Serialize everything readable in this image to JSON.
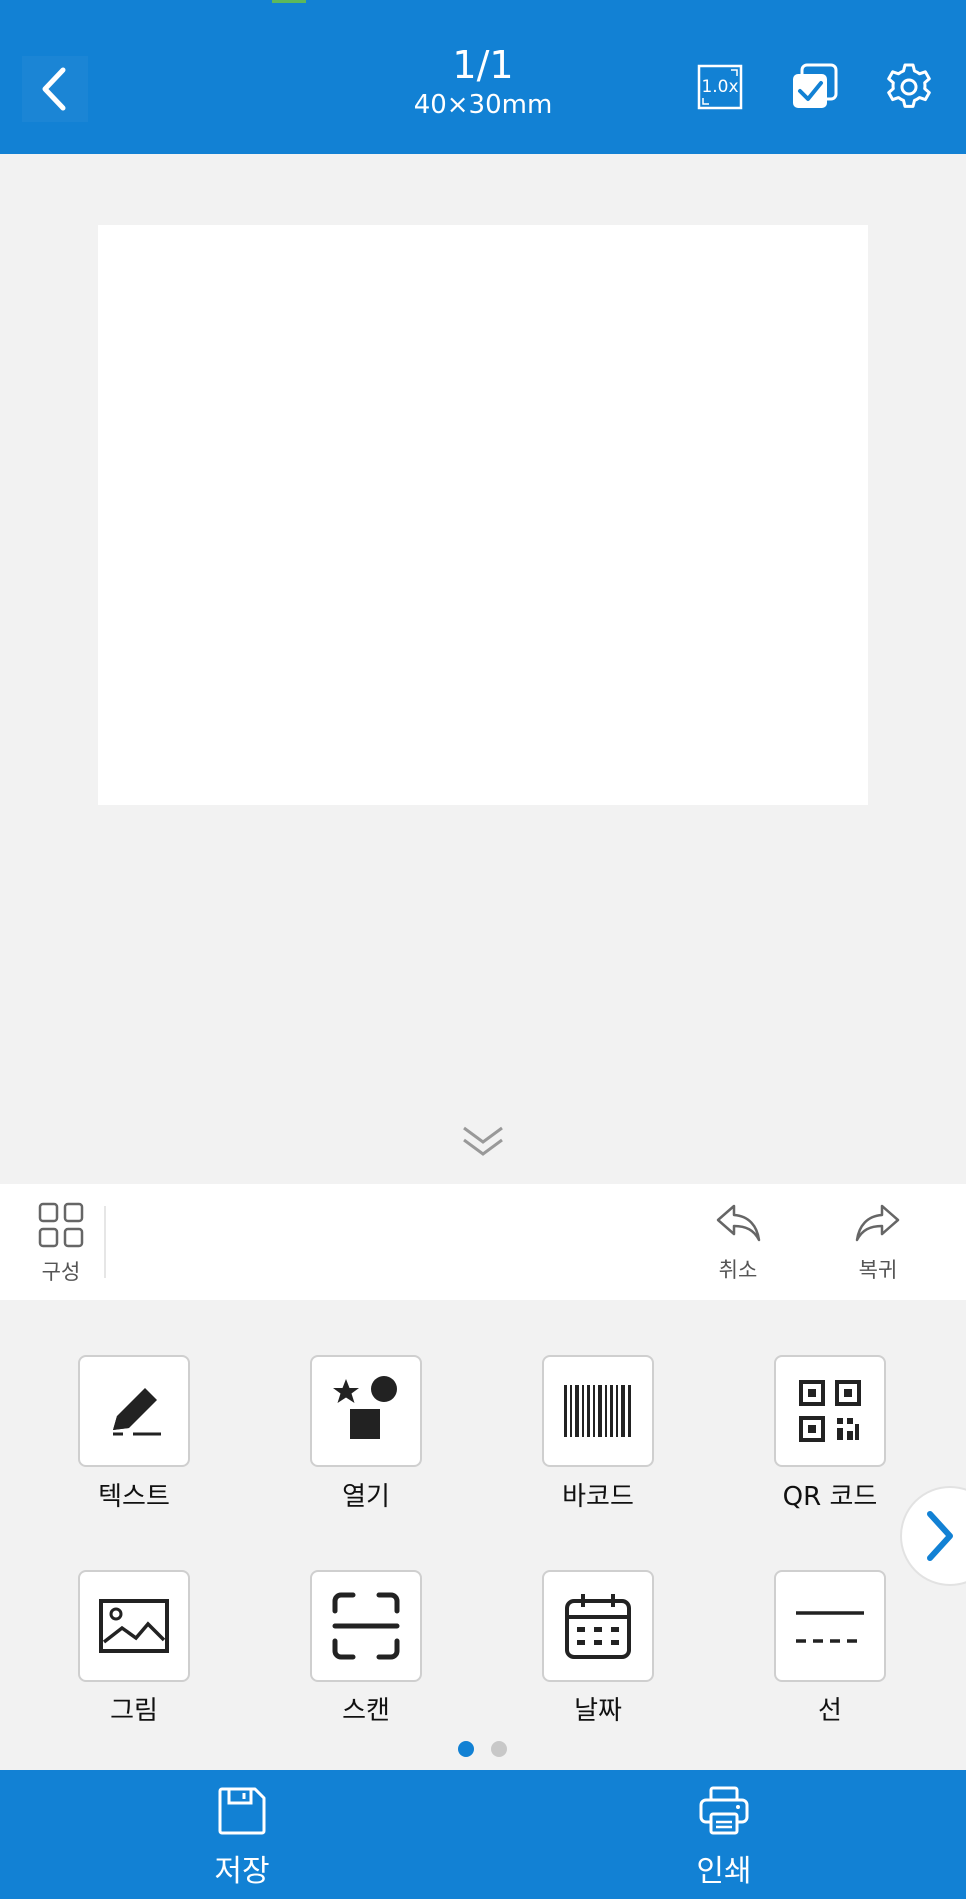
{
  "header": {
    "page_indicator": "1/1",
    "label_size": "40×30mm",
    "zoom_label": "1.0x"
  },
  "toolbar": {
    "layout_label": "구성",
    "undo_label": "취소",
    "redo_label": "복귀"
  },
  "elements": [
    {
      "label": "텍스트",
      "icon": "pencil-icon"
    },
    {
      "label": "열기",
      "icon": "shapes-icon"
    },
    {
      "label": "바코드",
      "icon": "barcode-icon"
    },
    {
      "label": "QR 코드",
      "icon": "qr-code-icon"
    },
    {
      "label": "그림",
      "icon": "image-icon"
    },
    {
      "label": "스캔",
      "icon": "scan-icon"
    },
    {
      "label": "날짜",
      "icon": "calendar-icon"
    },
    {
      "label": "선",
      "icon": "line-icon"
    }
  ],
  "pagination": {
    "current": 1,
    "total": 2
  },
  "bottom_bar": {
    "save_label": "저장",
    "print_label": "인쇄"
  },
  "colors": {
    "primary": "#1281d4",
    "background": "#f2f2f2"
  }
}
